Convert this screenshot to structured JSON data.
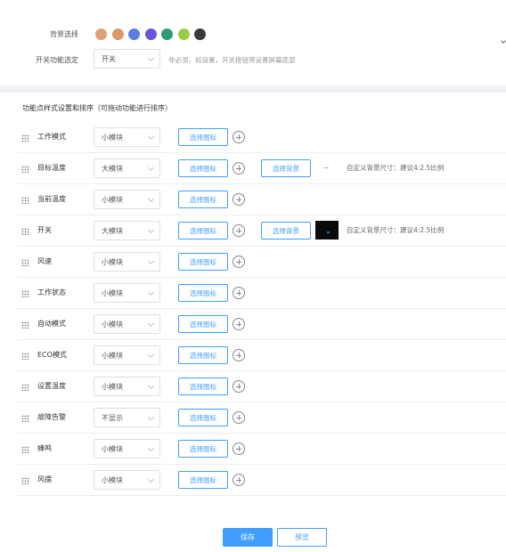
{
  "background": {
    "label": "背景选择",
    "swatches": [
      {
        "color": "#e0a07a",
        "name": "orange-swatch"
      },
      {
        "color": "#d99a66",
        "name": "tan-swatch"
      },
      {
        "color": "#5b7fe0",
        "name": "blue-swatch"
      },
      {
        "color": "#6a55d8",
        "name": "purple-swatch"
      },
      {
        "color": "#2f9a78",
        "name": "green-swatch"
      },
      {
        "color": "#9ccb4a",
        "name": "lime-swatch"
      },
      {
        "color": "#3a3a3a",
        "name": "dark-swatch"
      }
    ]
  },
  "switch_setting": {
    "label": "开关功能选定",
    "value": "开关",
    "hint": "非必须，如设置，开关按钮将设置屏幕底部"
  },
  "features": {
    "title": "功能点样式设置和排序（可拖动功能进行排序）",
    "select_icon_label": "选择图标",
    "select_bg_label": "选择背景",
    "bg_hint": "自定义背景尺寸：建议4:2.5比例",
    "rows": [
      {
        "name": "工作模式",
        "size": "小模块"
      },
      {
        "name": "目标温度",
        "size": "大模块",
        "bg": true,
        "thumb": false
      },
      {
        "name": "当前温度",
        "size": "小模块"
      },
      {
        "name": "开关",
        "size": "大模块",
        "bg": true,
        "thumb": true
      },
      {
        "name": "风速",
        "size": "小模块"
      },
      {
        "name": "工作状态",
        "size": "小模块"
      },
      {
        "name": "自动模式",
        "size": "小模块"
      },
      {
        "name": "ECO模式",
        "size": "小模块"
      },
      {
        "name": "设置温度",
        "size": "小模块"
      },
      {
        "name": "故障告警",
        "size": "不显示"
      },
      {
        "name": "蜂鸣",
        "size": "小模块"
      },
      {
        "name": "风摆",
        "size": "小模块"
      }
    ]
  },
  "footer": {
    "save_label": "保存",
    "preview_label": "预览"
  },
  "colors": {
    "accent": "#409eff"
  }
}
